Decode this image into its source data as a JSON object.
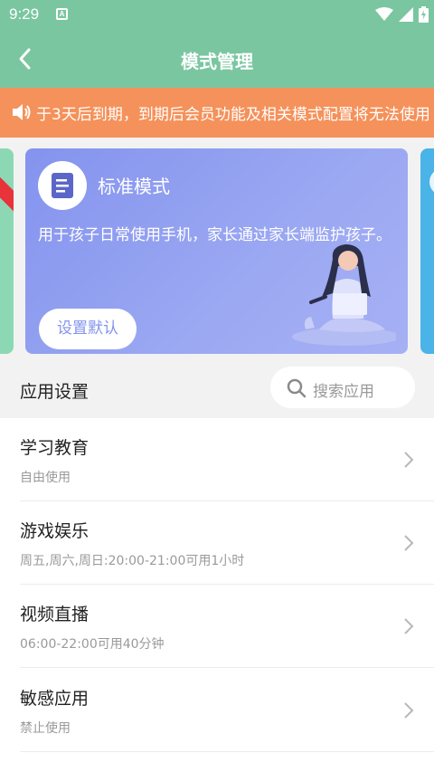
{
  "status": {
    "time": "9:29",
    "notif_letter": "A"
  },
  "appbar": {
    "title": "模式管理"
  },
  "notice": {
    "text": "于3天后到期，到期后会员功能及相关模式配置将无法使用"
  },
  "mode_card": {
    "title": "标准模式",
    "desc": "用于孩子日常使用手机，家长通过家长端监护孩子。",
    "button": "设置默认"
  },
  "section": {
    "label": "应用设置",
    "search_placeholder": "搜索应用"
  },
  "categories": [
    {
      "name": "学习教育",
      "rule": "自由使用"
    },
    {
      "name": "游戏娱乐",
      "rule": "周五,周六,周日:20:00-21:00可用1小时"
    },
    {
      "name": "视频直播",
      "rule": "06:00-22:00可用40分钟"
    },
    {
      "name": "敏感应用",
      "rule": "禁止使用"
    }
  ],
  "colors": {
    "header": "#7ac6a0",
    "notice": "#f5915a",
    "card": "#8493ee"
  }
}
